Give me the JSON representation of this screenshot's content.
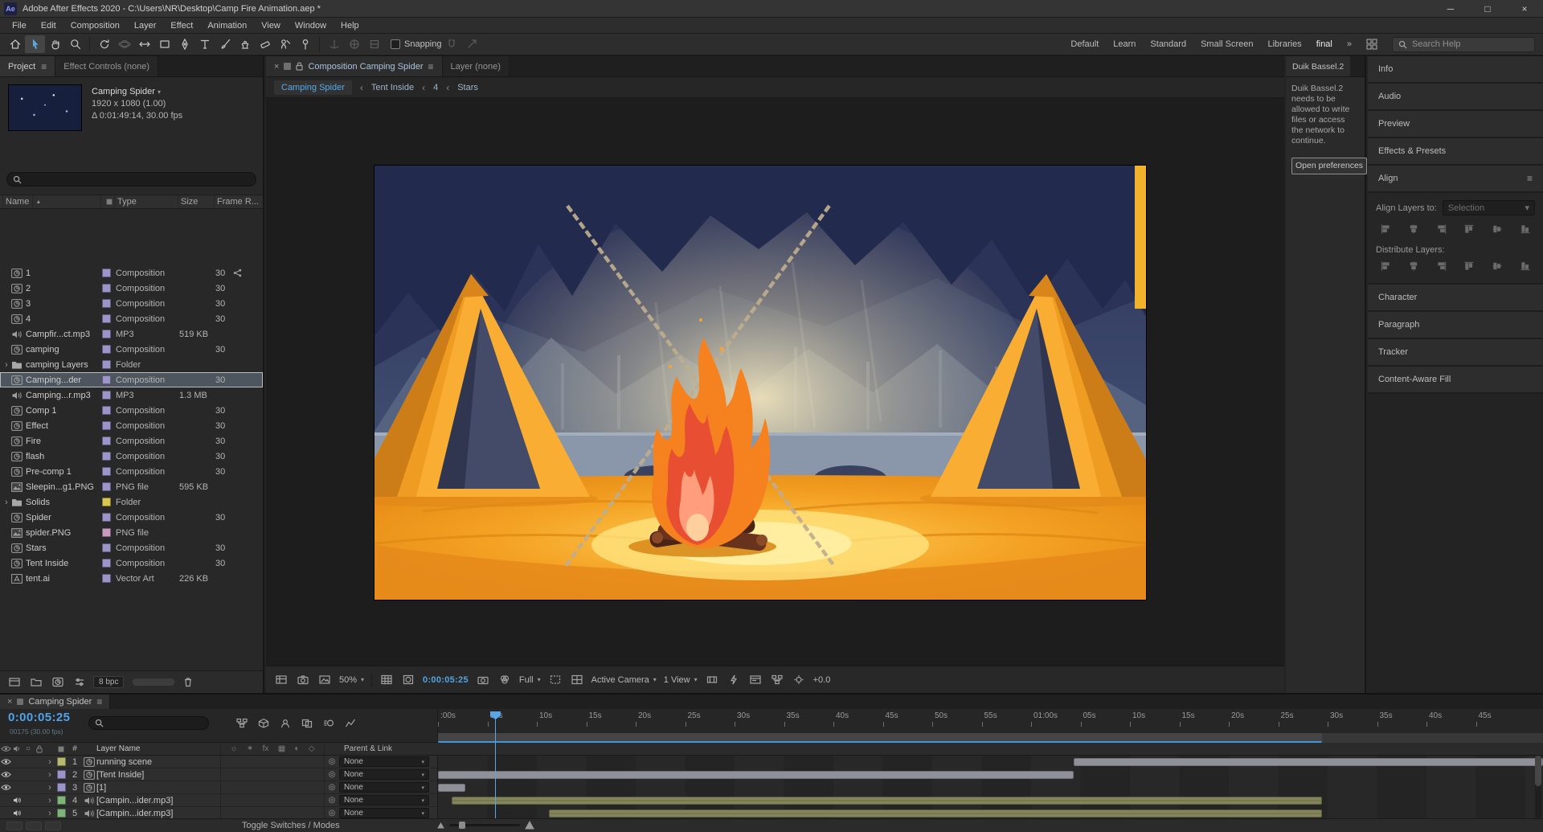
{
  "titlebar": {
    "app": "Ae",
    "title": "Adobe After Effects 2020 - C:\\Users\\NR\\Desktop\\Camp Fire Animation.aep *",
    "controls": {
      "minimize": "─",
      "maximize": "□",
      "close": "×"
    }
  },
  "menus": [
    "File",
    "Edit",
    "Composition",
    "Layer",
    "Effect",
    "Animation",
    "View",
    "Window",
    "Help"
  ],
  "toolbar": {
    "snapping": "Snapping",
    "workspaces": [
      "Default",
      "Learn",
      "Standard",
      "Small Screen",
      "Libraries",
      "final"
    ],
    "overflow": "»",
    "search_placeholder": "Search Help"
  },
  "project": {
    "tab_project": "Project",
    "tab_effect_controls": "Effect Controls (none)",
    "comp_name": "Camping Spider",
    "comp_size": "1920 x 1080 (1.00)",
    "comp_time": "Δ 0:01:49:14, 30.00 fps",
    "columns": {
      "name": "Name",
      "type": "Type",
      "size": "Size",
      "frame": "Frame R..."
    },
    "bpc": "8 bpc",
    "items": [
      {
        "name": "1",
        "type": "Composition",
        "size": "",
        "frame": "30",
        "kind": "comp",
        "label": "#9b95c9",
        "badge": "used"
      },
      {
        "name": "2",
        "type": "Composition",
        "size": "",
        "frame": "30",
        "kind": "comp",
        "label": "#9b95c9"
      },
      {
        "name": "3",
        "type": "Composition",
        "size": "",
        "frame": "30",
        "kind": "comp",
        "label": "#9b95c9"
      },
      {
        "name": "4",
        "type": "Composition",
        "size": "",
        "frame": "30",
        "kind": "comp",
        "label": "#9b95c9"
      },
      {
        "name": "Campfir...ct.mp3",
        "type": "MP3",
        "size": "519 KB",
        "frame": "",
        "kind": "audio",
        "label": "#9b95c9"
      },
      {
        "name": "camping",
        "type": "Composition",
        "size": "",
        "frame": "30",
        "kind": "comp",
        "label": "#9b95c9"
      },
      {
        "name": "camping Layers",
        "type": "Folder",
        "size": "",
        "frame": "",
        "kind": "folder",
        "label": "#9b95c9"
      },
      {
        "name": "Camping...der",
        "type": "Composition",
        "size": "",
        "frame": "30",
        "kind": "comp",
        "label": "#9b95c9",
        "selected": true
      },
      {
        "name": "Camping...r.mp3",
        "type": "MP3",
        "size": "1.3 MB",
        "frame": "",
        "kind": "audio",
        "label": "#9b95c9"
      },
      {
        "name": "Comp 1",
        "type": "Composition",
        "size": "",
        "frame": "30",
        "kind": "comp",
        "label": "#9b95c9"
      },
      {
        "name": "Effect",
        "type": "Composition",
        "size": "",
        "frame": "30",
        "kind": "comp",
        "label": "#9b95c9"
      },
      {
        "name": "Fire",
        "type": "Composition",
        "size": "",
        "frame": "30",
        "kind": "comp",
        "label": "#9b95c9"
      },
      {
        "name": "flash",
        "type": "Composition",
        "size": "",
        "frame": "30",
        "kind": "comp",
        "label": "#9b95c9"
      },
      {
        "name": "Pre-comp 1",
        "type": "Composition",
        "size": "",
        "frame": "30",
        "kind": "comp",
        "label": "#9b95c9"
      },
      {
        "name": "Sleepin...g1.PNG",
        "type": "PNG file",
        "size": "595 KB",
        "frame": "",
        "kind": "image",
        "label": "#9b95c9"
      },
      {
        "name": "Solids",
        "type": "Folder",
        "size": "",
        "frame": "",
        "kind": "folder",
        "label": "#d8c64e"
      },
      {
        "name": "Spider",
        "type": "Composition",
        "size": "",
        "frame": "30",
        "kind": "comp",
        "label": "#9b95c9"
      },
      {
        "name": "spider.PNG",
        "type": "PNG file",
        "size": "",
        "frame": "",
        "kind": "image",
        "label": "#c99bc0"
      },
      {
        "name": "Stars",
        "type": "Composition",
        "size": "",
        "frame": "30",
        "kind": "comp",
        "label": "#9b95c9"
      },
      {
        "name": "Tent Inside",
        "type": "Composition",
        "size": "",
        "frame": "30",
        "kind": "comp",
        "label": "#9b95c9"
      },
      {
        "name": "tent.ai",
        "type": "Vector Art",
        "size": "226 KB",
        "frame": "",
        "kind": "vector",
        "label": "#9b95c9"
      }
    ]
  },
  "viewer": {
    "tab_comp_prefix": "Composition",
    "tab_comp_name": "Camping Spider",
    "tab_layer": "Layer  (none)",
    "breadcrumbs": [
      "Camping Spider",
      "Tent Inside",
      "4",
      "Stars"
    ],
    "zoom": "50%",
    "timecode": "0:00:05:25",
    "resolution": "Full",
    "camera": "Active Camera",
    "view": "1 View",
    "exposure": "+0.0"
  },
  "duik": {
    "title": "Duik Bassel.2",
    "message": "Duik Bassel.2 needs to be allowed to write files or access the network to continue.",
    "button": "Open preferences"
  },
  "sidebar": {
    "panels": [
      "Info",
      "Audio",
      "Preview",
      "Effects & Presets"
    ],
    "align": {
      "title": "Align",
      "align_layers_to": "Align Layers to:",
      "selection": "Selection",
      "distribute": "Distribute Layers:"
    },
    "panels_bottom": [
      "Character",
      "Paragraph",
      "Tracker",
      "Content-Aware Fill"
    ]
  },
  "timeline": {
    "tab": "Camping Spider",
    "timecode": "0:00:05:25",
    "frame_info": "00175 (30.00 fps)",
    "ruler": [
      ":00s",
      "05s",
      "10s",
      "15s",
      "20s",
      "25s",
      "30s",
      "35s",
      "40s",
      "45s",
      "50s",
      "55s",
      "01:00s",
      "05s",
      "10s",
      "15s",
      "20s",
      "25s",
      "30s",
      "35s",
      "40s",
      "45s"
    ],
    "columns": {
      "num": "#",
      "layer_name": "Layer Name",
      "parent": "Parent & Link"
    },
    "layers": [
      {
        "num": "1",
        "name": "running scene",
        "parent": "None",
        "kind": "video",
        "label": "#b8b871",
        "bar": {
          "start": 0.575,
          "end": 1.0
        }
      },
      {
        "num": "2",
        "name": "[Tent Inside]",
        "parent": "None",
        "kind": "video",
        "label": "#9a94c8",
        "bar": {
          "start": 0.0,
          "end": 0.575
        }
      },
      {
        "num": "3",
        "name": "[1]",
        "parent": "None",
        "kind": "video",
        "label": "#9a94c8",
        "bar": {
          "start": 0.0,
          "end": 0.025
        }
      },
      {
        "num": "4",
        "name": "[Campin...ider.mp3]",
        "parent": "None",
        "kind": "audio",
        "label": "#7fb37a",
        "bar": {
          "start": 0.012,
          "end": 0.8
        }
      },
      {
        "num": "5",
        "name": "[Campin...ider.mp3]",
        "parent": "None",
        "kind": "audio",
        "label": "#7fb37a",
        "bar": {
          "start": 0.1,
          "end": 0.8
        }
      }
    ],
    "toggle_label": "Toggle Switches / Modes"
  }
}
